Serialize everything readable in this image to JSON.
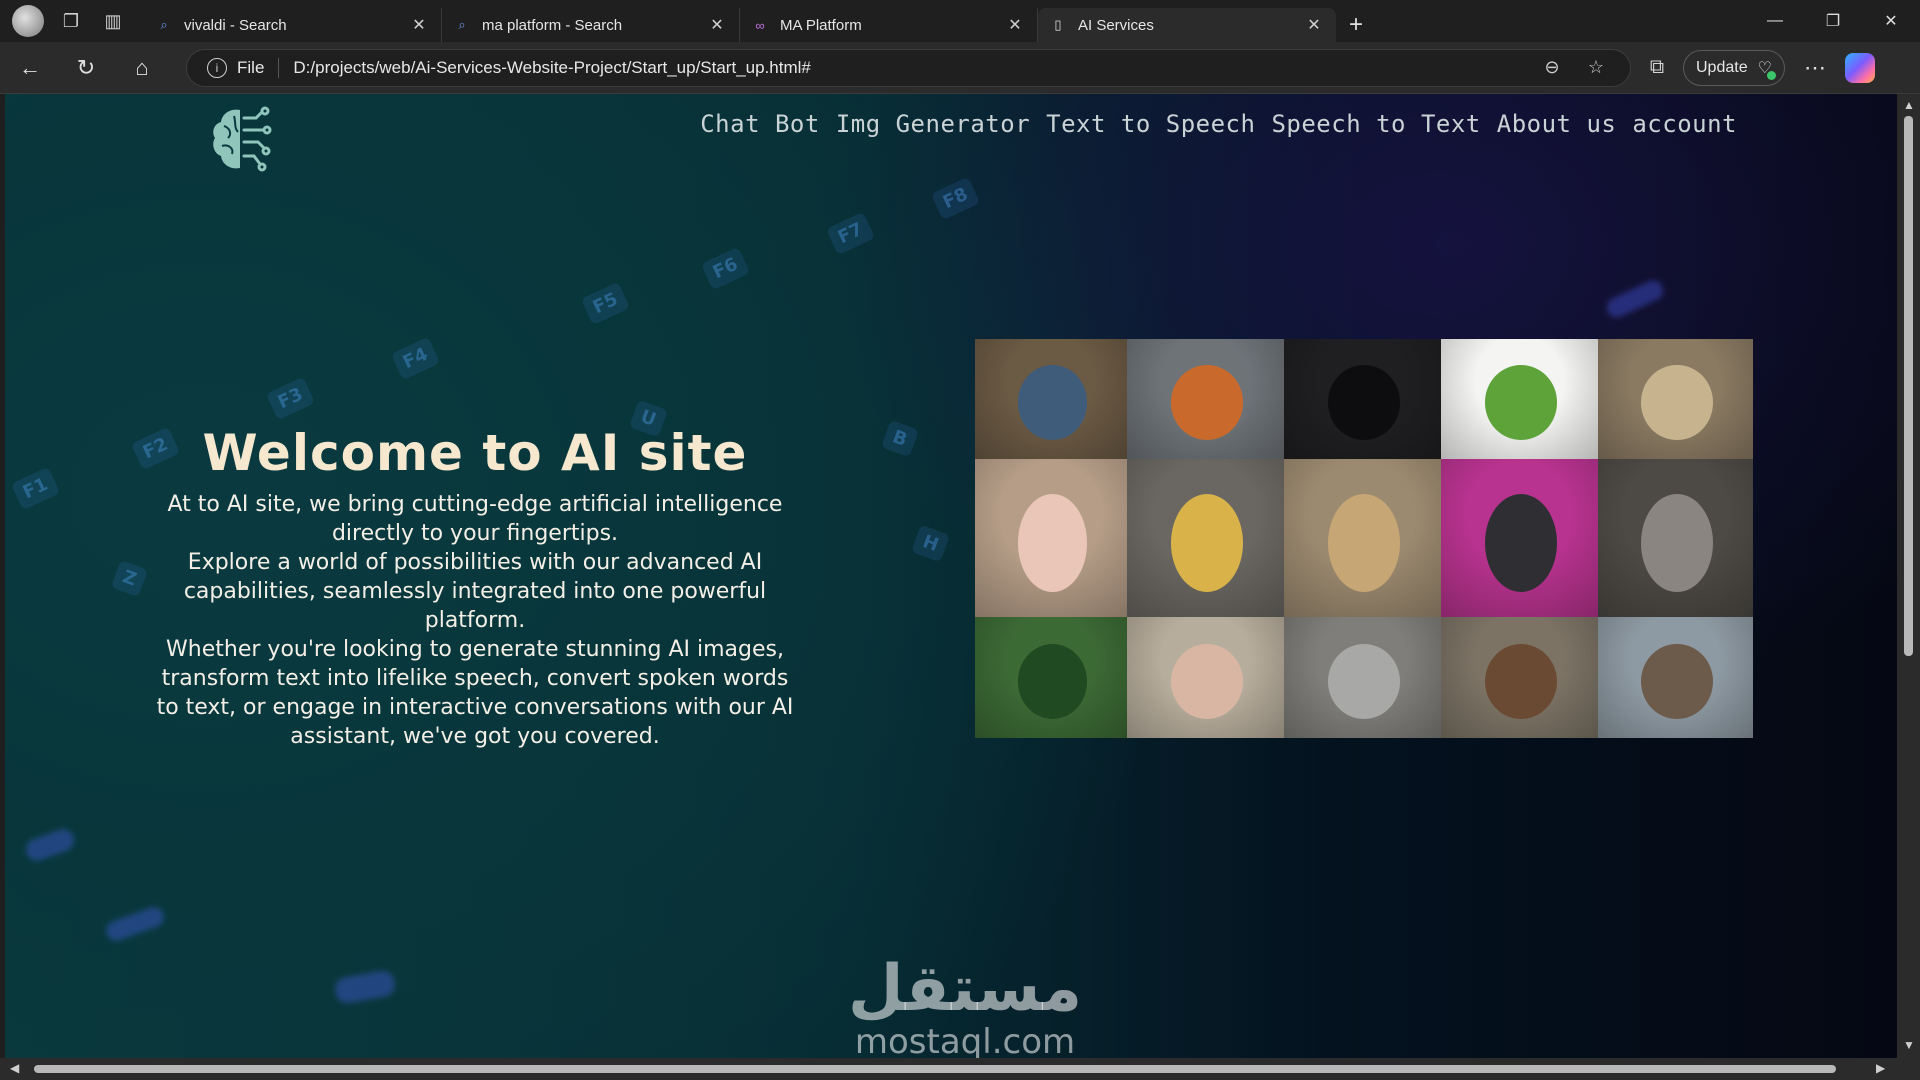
{
  "browser": {
    "tabs": [
      {
        "title": "vivaldi - Search",
        "icon": "search-icon"
      },
      {
        "title": "ma platform - Search",
        "icon": "search-icon"
      },
      {
        "title": "MA Platform",
        "icon": "ma-platform-favicon"
      },
      {
        "title": "AI Services",
        "icon": "page-icon"
      }
    ],
    "address": {
      "scheme_label": "File",
      "url": "D:/projects/web/Ai-Services-Website-Project/Start_up/Start_up.html#"
    },
    "update_label": "Update"
  },
  "site": {
    "nav": [
      "Chat Bot",
      "Img Generator",
      "Text to Speech",
      "Speech to Text",
      "About us",
      "account"
    ],
    "hero": {
      "title": "Welcome to AI site",
      "paragraph_1": "At to AI site, we bring cutting-edge artificial intelligence directly to your fingertips.",
      "paragraph_2": "Explore a world of possibilities with our advanced AI capabilities, seamlessly integrated into one powerful platform.",
      "paragraph_3": "Whether you're looking to generate stunning AI images, transform text into lifelike speech, convert spoken words to text, or engage in interactive conversations with our AI assistant, we've got you covered."
    },
    "keyboard_keys": [
      "F1",
      "F2",
      "F3",
      "F4",
      "F5",
      "F6",
      "F7",
      "F8",
      "Z",
      "U",
      "B",
      "H"
    ],
    "gallery": [
      {
        "name": "gnome-coffee-image",
        "bg": "#6b5a44",
        "fg": "#3f5d7a"
      },
      {
        "name": "astronaut-image",
        "bg": "#6e7378",
        "fg": "#c96a2c"
      },
      {
        "name": "crow-hood-image",
        "bg": "#1f1f22",
        "fg": "#0d0d0f"
      },
      {
        "name": "broccoli-image",
        "bg": "#f4f4f2",
        "fg": "#5da33a"
      },
      {
        "name": "castle-ruins-image",
        "bg": "#8a7a62",
        "fg": "#c8b38f"
      },
      {
        "name": "pig-doctor-image",
        "bg": "#b59d87",
        "fg": "#e9c6b8"
      },
      {
        "name": "duck-helmet-image",
        "bg": "#6a6762",
        "fg": "#d9b34a"
      },
      {
        "name": "stone-house-image",
        "bg": "#9c8a70",
        "fg": "#c7a676"
      },
      {
        "name": "retro-computer-image",
        "bg": "#b8338f",
        "fg": "#2f2f33"
      },
      {
        "name": "robot-beer-image",
        "bg": "#4d4a45",
        "fg": "#8a8580"
      },
      {
        "name": "forest-image",
        "bg": "#3c6a35",
        "fg": "#1f4a22"
      },
      {
        "name": "pig-warrior-image",
        "bg": "#b7ad9c",
        "fg": "#d9b6a4"
      },
      {
        "name": "mouse-image",
        "bg": "#7f7e7a",
        "fg": "#a8a8a6"
      },
      {
        "name": "otter-goggles-image",
        "bg": "#7c7365",
        "fg": "#6b4a33"
      },
      {
        "name": "otter-hood-image",
        "bg": "#8e9aa3",
        "fg": "#6c5a4a"
      }
    ]
  },
  "watermark": {
    "arabic": "مستقل",
    "latin": "mostaql.com"
  }
}
